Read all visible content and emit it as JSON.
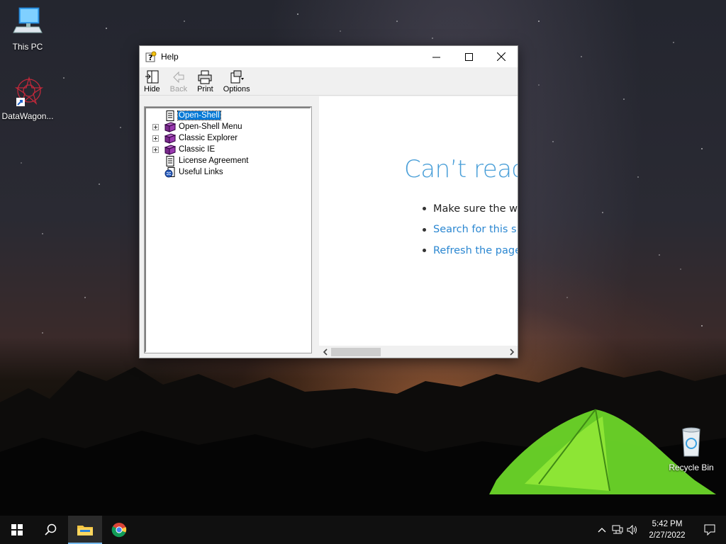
{
  "desktop": {
    "icons": [
      {
        "name": "this-pc",
        "label": "This PC"
      },
      {
        "name": "datawagon",
        "label": "DataWagon..."
      },
      {
        "name": "recycle-bin",
        "label": "Recycle Bin"
      }
    ]
  },
  "window": {
    "title": "Help",
    "toolbar": {
      "hide": "Hide",
      "back": "Back",
      "print": "Print",
      "options": "Options"
    },
    "tree": [
      {
        "label": "Open-Shell",
        "icon": "page-icon",
        "expandable": false,
        "selected": true
      },
      {
        "label": "Open-Shell Menu",
        "icon": "book-icon",
        "expandable": true,
        "selected": false
      },
      {
        "label": "Classic Explorer",
        "icon": "book-icon",
        "expandable": true,
        "selected": false
      },
      {
        "label": "Classic IE",
        "icon": "book-icon",
        "expandable": true,
        "selected": false
      },
      {
        "label": "License Agreement",
        "icon": "page-icon",
        "expandable": false,
        "selected": false
      },
      {
        "label": "Useful Links",
        "icon": "web-page-icon",
        "expandable": false,
        "selected": false
      }
    ],
    "content": {
      "error_title": "Can’t reach",
      "bullets": [
        {
          "text": "Make sure the wel",
          "link": false
        },
        {
          "text": "Search for this site",
          "link": true
        },
        {
          "text": "Refresh the page",
          "link": true
        }
      ]
    }
  },
  "taskbar": {
    "time": "5:42 PM",
    "date": "2/27/2022",
    "pinned": [
      "start-icon",
      "search-icon",
      "file-explorer-icon",
      "chrome-icon"
    ]
  },
  "colors": {
    "accent": "#0078d7",
    "link": "#2b87d1",
    "error_title": "#4a9fd8",
    "taskbar": "#101010"
  }
}
